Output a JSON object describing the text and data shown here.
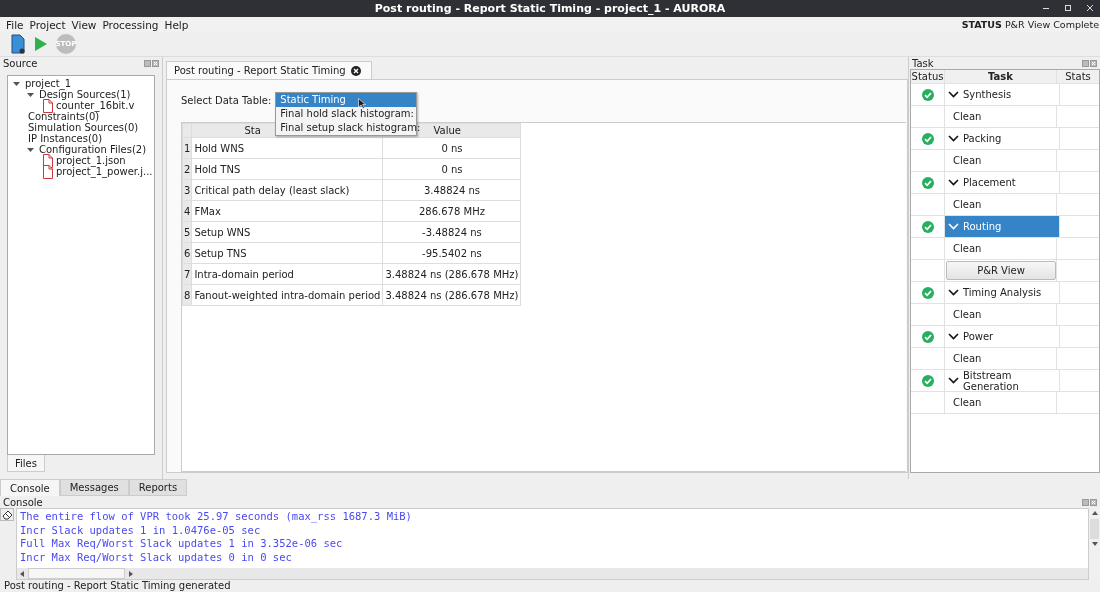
{
  "window": {
    "title": "Post routing - Report Static Timing - project_1 - AURORA"
  },
  "menu": [
    "File",
    "Project",
    "View",
    "Processing",
    "Help"
  ],
  "status_indicator": {
    "label": "STATUS",
    "value": "P&R View Complete"
  },
  "toolbar": {
    "stop_button": {
      "label": "STOP",
      "disabled": true
    }
  },
  "source_panel": {
    "title": "Source",
    "tree": [
      {
        "label": "project_1",
        "expanded": true,
        "children": [
          {
            "label": "Design Sources(1)",
            "expanded": true,
            "children": [
              {
                "label": "counter_16bit.v",
                "kind": "file"
              }
            ]
          },
          {
            "label": "Constraints(0)"
          },
          {
            "label": "Simulation Sources(0)"
          },
          {
            "label": "IP Instances(0)"
          },
          {
            "label": "Configuration Files(2)",
            "expanded": true,
            "children": [
              {
                "label": "project_1.json",
                "kind": "file"
              },
              {
                "label": "project_1_power.j...",
                "kind": "file"
              }
            ]
          }
        ]
      }
    ],
    "tabs": [
      {
        "label": "Files",
        "selected": true
      }
    ]
  },
  "editor": {
    "tabs": [
      {
        "label": "Post routing - Report Static Timing",
        "selected": true
      }
    ],
    "select_label": "Select Data Table:",
    "dropdown": [
      {
        "label": "Static Timing",
        "selected": true
      },
      {
        "label": "Final hold slack histogram:",
        "selected": false
      },
      {
        "label": "Final setup slack histogram:",
        "selected": false
      }
    ],
    "table": {
      "columns": [
        "Sta",
        "Value"
      ],
      "rows": [
        {
          "index": "1",
          "name": "Hold WNS",
          "value": "0 ns"
        },
        {
          "index": "2",
          "name": "Hold TNS",
          "value": "0 ns"
        },
        {
          "index": "3",
          "name": "Critical path delay (least slack)",
          "value": "3.48824 ns"
        },
        {
          "index": "4",
          "name": "FMax",
          "value": "286.678 MHz"
        },
        {
          "index": "5",
          "name": "Setup WNS",
          "value": "-3.48824 ns"
        },
        {
          "index": "6",
          "name": "Setup TNS",
          "value": "-95.5402 ns"
        },
        {
          "index": "7",
          "name": "Intra-domain period",
          "value": "3.48824 ns (286.678 MHz)"
        },
        {
          "index": "8",
          "name": "Fanout-weighted intra-domain period",
          "value": "3.48824 ns (286.678 MHz)"
        }
      ]
    }
  },
  "task_panel": {
    "title": "Task",
    "columns": [
      "Status",
      "Task",
      "Stats"
    ],
    "tasks": [
      {
        "label": "Synthesis",
        "done": true,
        "expanded": true,
        "selected": false,
        "children": [
          {
            "kind": "step",
            "label": "Clean"
          }
        ]
      },
      {
        "label": "Packing",
        "done": true,
        "expanded": true,
        "selected": false,
        "children": [
          {
            "kind": "step",
            "label": "Clean"
          }
        ]
      },
      {
        "label": "Placement",
        "done": true,
        "expanded": true,
        "selected": false,
        "children": [
          {
            "kind": "step",
            "label": "Clean"
          }
        ]
      },
      {
        "label": "Routing",
        "done": true,
        "expanded": true,
        "selected": true,
        "children": [
          {
            "kind": "step",
            "label": "Clean"
          },
          {
            "kind": "button",
            "label": "P&R View"
          }
        ]
      },
      {
        "label": "Timing Analysis",
        "done": true,
        "expanded": true,
        "selected": false,
        "children": [
          {
            "kind": "step",
            "label": "Clean"
          }
        ]
      },
      {
        "label": "Power",
        "done": true,
        "expanded": true,
        "selected": false,
        "children": [
          {
            "kind": "step",
            "label": "Clean"
          }
        ]
      },
      {
        "label": "Bitstream Generation",
        "done": true,
        "expanded": true,
        "selected": false,
        "children": [
          {
            "kind": "step",
            "label": "Clean"
          }
        ]
      }
    ]
  },
  "bottom_tabs": [
    {
      "label": "Console",
      "selected": true
    },
    {
      "label": "Messages",
      "selected": false
    },
    {
      "label": "Reports",
      "selected": false
    }
  ],
  "console": {
    "title": "Console",
    "lines": [
      "The entire flow of VPR took 25.97 seconds (max_rss 1687.3 MiB)",
      "Incr Slack updates 1 in 1.0476e-05 sec",
      "Full Max Req/Worst Slack updates 1 in 3.352e-06 sec",
      "Incr Max Req/Worst Slack updates 0 in 0 sec"
    ]
  },
  "status_bar": "Post routing - Report Static Timing generated"
}
